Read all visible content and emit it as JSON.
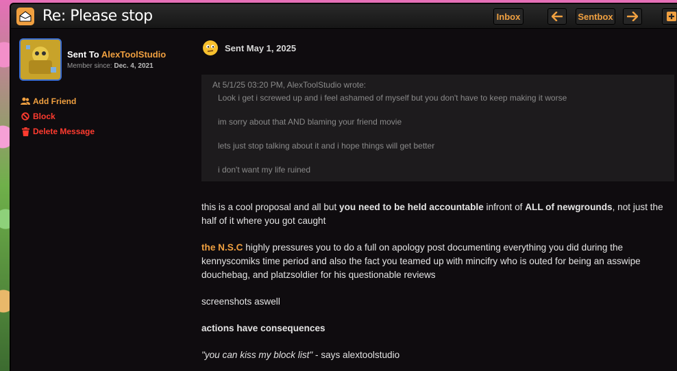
{
  "window": {
    "title": "Re: Please stop"
  },
  "nav": {
    "inbox": "Inbox",
    "sentbox": "Sentbox",
    "prev_icon": "arrow-left-icon",
    "next_icon": "arrow-right-icon",
    "new_icon": "new-message-icon"
  },
  "sidebar": {
    "sent_to_label": "Sent To",
    "username": "AlexToolStudio",
    "member_since_label": "Member since:",
    "member_since_date": "Dec. 4, 2021",
    "actions": [
      {
        "label": "Add Friend",
        "icon": "add-friend-icon"
      },
      {
        "label": "Block",
        "icon": "block-icon"
      },
      {
        "label": "Delete Message",
        "icon": "trash-icon"
      }
    ]
  },
  "message": {
    "sent_label": "Sent May 1, 2025",
    "quote": {
      "header": "At 5/1/25 03:20 PM, AlexToolStudio wrote:",
      "lines": [
        "Look i get i screwed up and i feel ashamed of myself but you don't have to keep making it worse",
        "im sorry about that AND blaming your friend movie",
        "lets just stop talking about it and i hope things will get better",
        "i don't want my life ruined"
      ]
    },
    "p1": {
      "a": "this is a cool proposal and all but ",
      "b": "you need to be held accountable",
      "c": " infront of ",
      "d": "ALL of newgrounds",
      "e": ", not just the half of it where you got caught"
    },
    "p2": {
      "a": "the N.S.C",
      "b": " highly pressures you to do a full on apology post documenting everything you did during the kennyscomiks time period and also the fact you teamed up with mincifry who is outed for being an asswipe douchebag, and platzsoldier for his questionable reviews"
    },
    "p3": "screenshots aswell",
    "p4": "actions have consequences",
    "p5": {
      "a": "\"you can kiss my block list\"",
      "b": " - says alextoolstudio"
    }
  },
  "colors": {
    "accent": "#f0a040",
    "danger": "#ff3b2f",
    "background": "#0f0c0f"
  }
}
